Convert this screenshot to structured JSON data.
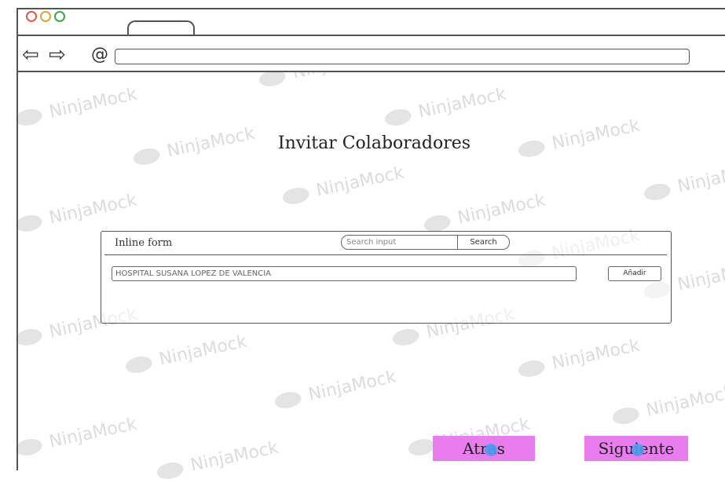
{
  "watermark": {
    "text": "NinjaMock"
  },
  "browser": {
    "window_controls": [
      "close",
      "minimize",
      "maximize"
    ],
    "window_control_colors": [
      "#e05a4a",
      "#e0a43a",
      "#3aa84a"
    ],
    "nav_back_icon": "⇦",
    "nav_forward_icon": "⇨",
    "refresh_icon": "@",
    "url": ""
  },
  "page": {
    "title": "Invitar Colaboradores"
  },
  "form": {
    "title": "Inline form",
    "search_placeholder": "Search input",
    "search_button": "Search",
    "hospital_value": "HOSPITAL SUSANA LOPEZ DE VALENCIA",
    "add_button": "Añadir"
  },
  "footer": {
    "back_button": "Atras",
    "next_button": "Siguiente",
    "button_color": "#e97df0"
  }
}
